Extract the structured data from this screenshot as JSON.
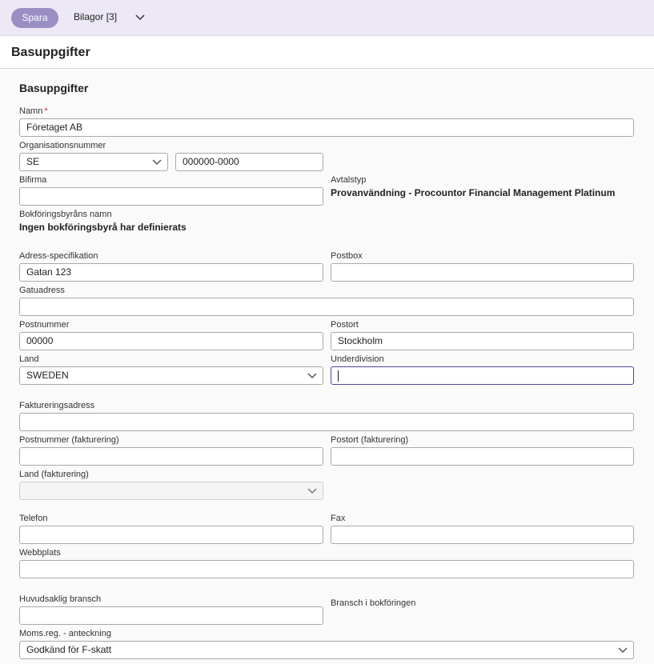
{
  "toolbar": {
    "save_label": "Spara",
    "attachments_label": "Bilagor [3]"
  },
  "header": {
    "title": "Basuppgifter"
  },
  "section": {
    "title": "Basuppgifter"
  },
  "form": {
    "name": {
      "label": "Namn",
      "required_mark": "*",
      "value": "Företaget AB"
    },
    "org_number": {
      "label": "Organisationsnummer",
      "country": "SE",
      "value": "000000-0000"
    },
    "bifirma": {
      "label": "Bifirma",
      "value": ""
    },
    "agreement": {
      "label": "Avtalstyp",
      "value": "Provanvändning - Procountor Financial Management Platinum"
    },
    "bureau": {
      "label": "Bokföringsbyråns namn",
      "value": "Ingen bokföringsbyrå har definierats"
    },
    "address_spec": {
      "label": "Adress-specifikation",
      "value": "Gatan 123"
    },
    "postbox": {
      "label": "Postbox",
      "value": ""
    },
    "street": {
      "label": "Gatuadress",
      "value": ""
    },
    "postal_code": {
      "label": "Postnummer",
      "value": "00000"
    },
    "city": {
      "label": "Postort",
      "value": "Stockholm"
    },
    "country": {
      "label": "Land",
      "value": "SWEDEN"
    },
    "subdivision": {
      "label": "Underdivision",
      "value": ""
    },
    "billing_address": {
      "label": "Faktureringsadress",
      "value": ""
    },
    "billing_postal_code": {
      "label": "Postnummer (fakturering)",
      "value": ""
    },
    "billing_city": {
      "label": "Postort (fakturering)",
      "value": ""
    },
    "billing_country": {
      "label": "Land (fakturering)",
      "value": ""
    },
    "phone": {
      "label": "Telefon",
      "value": ""
    },
    "fax": {
      "label": "Fax",
      "value": ""
    },
    "website": {
      "label": "Webbplats",
      "value": ""
    },
    "main_industry": {
      "label": "Huvudsaklig bransch",
      "value": ""
    },
    "accounting_industry": {
      "label": "Bransch i bokföringen"
    },
    "vat_note": {
      "label": "Moms.reg. - anteckning",
      "value": "Godkänd för F-skatt"
    }
  },
  "icons": {
    "chevron": "chevron-down-icon"
  },
  "colors": {
    "accent": "#9a8fc4",
    "toolbar_bg": "#ece8f5",
    "focus_border": "#4b4894",
    "required": "#c0392b"
  }
}
